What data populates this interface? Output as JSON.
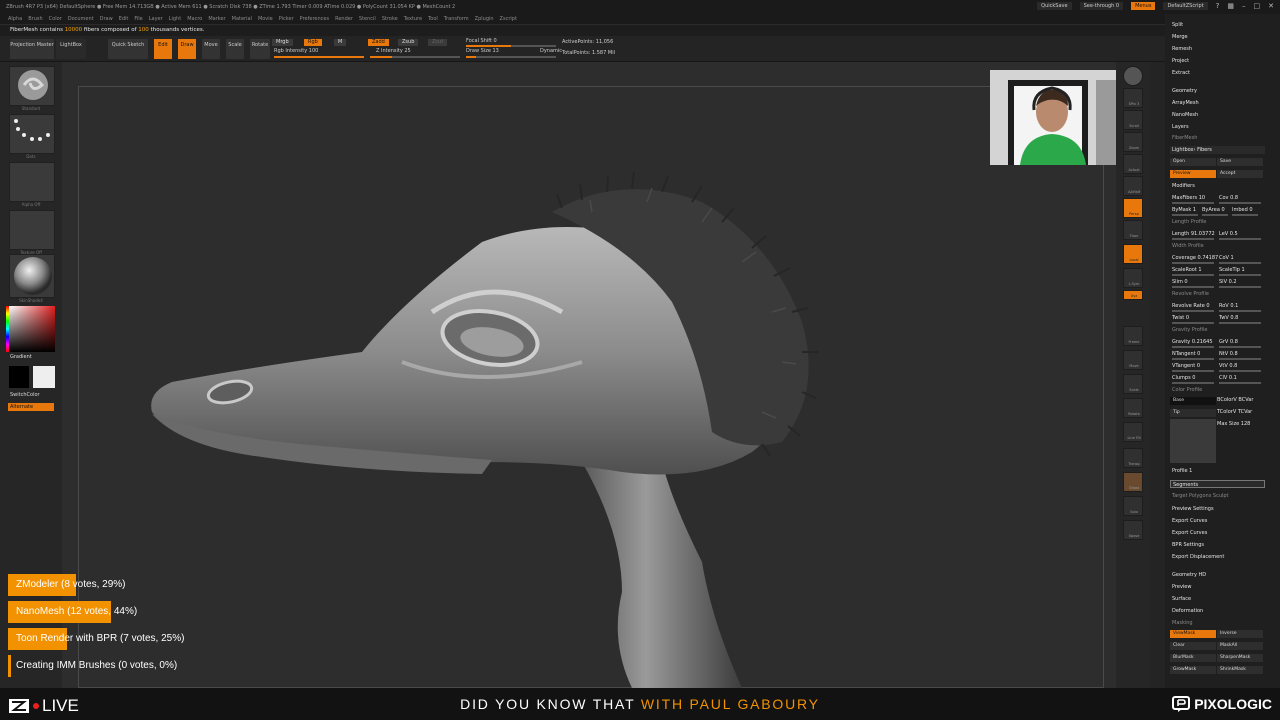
{
  "titlebar": {
    "title": "ZBrush 4R7 P3 (x64)   DefaultSphere   ● Free Mem 14.713GB ● Active Mem 611 ● Scratch Disk 738 ● ZTime 1.793 Timer 0.009 ATime 0.029 ● PolyCount 31.054 KP ● MeshCount 2",
    "quicksave": "QuickSave",
    "seethrough": "See-through  0",
    "menus_btn": "Menus",
    "script": "DefaultZScript"
  },
  "menubar": [
    "Alpha",
    "Brush",
    "Color",
    "Document",
    "Draw",
    "Edit",
    "File",
    "Layer",
    "Light",
    "Macro",
    "Marker",
    "Material",
    "Movie",
    "Picker",
    "Preferences",
    "Render",
    "Stencil",
    "Stroke",
    "Texture",
    "Tool",
    "Transform",
    "Zplugin",
    "Zscript"
  ],
  "notice": {
    "prefix": "FiberMesh contains ",
    "fibers": "10000",
    "mid": " fibers composed of ",
    "verts": "100",
    "suffix": " thousands vertices."
  },
  "toolbar": {
    "projection_master": "Projection Master",
    "lightbox": "LightBox",
    "quick_sketch": "Quick Sketch",
    "edit": "Edit",
    "draw": "Draw",
    "move": "Move",
    "scale": "Scale",
    "rotate": "Rotate",
    "mrgb": "Mrgb",
    "rgb": "Rgb",
    "m": "M",
    "rgb_intensity": "Rgb Intensity 100",
    "zadd": "Zadd",
    "zsub": "Zsub",
    "zcut": "Zcut",
    "z_intensity": "Z Intensity 25",
    "focal_shift": "Focal Shift 0",
    "draw_size": "Draw Size 13",
    "dynamic": "Dynamic",
    "active_points": "ActivePoints: 11,056",
    "total_points": "TotalPoints: 1.587 Mil"
  },
  "leftshelf": {
    "brush": "Standard",
    "stroke": "Dots",
    "alpha": "Alpha Off",
    "texture": "Texture Off",
    "material": "SkinShade4",
    "gradient": "Gradient",
    "switchcolor": "SwitchColor",
    "alternate": "Alternate"
  },
  "rightshelf": [
    "SPix 3",
    "Scroll",
    "Zoom",
    "Actual",
    "AAHalf",
    "Persp",
    "Floor",
    "Local",
    "L.Sym",
    "Xyz",
    "Frame",
    "Move",
    "Scale",
    "Rotate",
    "Line Fill",
    "Transp",
    "Ghost",
    "Solo",
    "Xpose"
  ],
  "tray": {
    "top": [
      "Split",
      "Merge",
      "Remesh",
      "Project",
      "Extract"
    ],
    "sub": [
      "Geometry",
      "ArrayMesh",
      "NanoMesh",
      "Layers",
      "FiberMesh"
    ],
    "lightbox_fibers": "Lightbox› Fibers",
    "open": "Open",
    "save": "Save",
    "preview": "Preview",
    "accept": "Accept",
    "modifiers": "Modifiers",
    "rows": [
      [
        "MaxFibers 10",
        "Cov 0.8"
      ],
      [
        "ByMask 1",
        "ByArea 0",
        "Imbed 0"
      ],
      [
        "Length Profile",
        ""
      ],
      [
        "Length 91.03772",
        "LeV 0.5"
      ],
      [
        "Width Profile",
        ""
      ],
      [
        "Coverage 0.74187",
        "CoV 1"
      ],
      [
        "ScaleRoot 1",
        "ScaleTip 1"
      ],
      [
        "Slim 0",
        "SlV 0.2"
      ],
      [
        "Revolve Profile",
        ""
      ],
      [
        "Revolve Rate 0",
        "RoV 0.1"
      ],
      [
        "Twist 0",
        "TwV 0.8"
      ],
      [
        "Gravity Profile",
        ""
      ],
      [
        "Gravity 0.21645",
        "GrV 0.8"
      ],
      [
        "NTangent 0",
        "NtV 0.8"
      ],
      [
        "VTangent 0",
        "VtV 0.8"
      ],
      [
        "Clumps 0",
        "ClV 0.1"
      ],
      [
        "Color Profile",
        ""
      ]
    ],
    "base": "Base",
    "tip": "Tip",
    "bcolor": "BColorV BCVar",
    "tcolor": "TColorV TCVar",
    "max_size": "Max Size 128",
    "profile": "Profile 1",
    "segments": "Segments",
    "target_polygons": "Target Polygons  Sculpt",
    "bottom_items": [
      "Preview Settings",
      "Export Curves",
      "Export Curves",
      "BPR Settings",
      "Export Displacement"
    ],
    "groups": [
      "Geometry HD",
      "Preview",
      "Surface",
      "Deformation",
      "Masking"
    ],
    "mask_buttons": [
      [
        "ViewMask",
        "Inverse"
      ],
      [
        "Clear",
        "MaskAll"
      ],
      [
        "BlurMask",
        "SharpenMask"
      ],
      [
        "GrowMask",
        "ShrinkMask"
      ]
    ]
  },
  "poll": [
    {
      "label": "ZModeler (8 votes, 29%)",
      "pct": 29
    },
    {
      "label": "NanoMesh (12 votes, 44%)",
      "pct": 44
    },
    {
      "label": "Toon Render with BPR (7 votes, 25%)",
      "pct": 25
    },
    {
      "label": "Creating IMM Brushes (0 votes, 0%)",
      "pct": 0
    }
  ],
  "bottombar": {
    "live": "LIVE",
    "prefix": "DID YOU KNOW THAT ",
    "highlight": "WITH PAUL GABOURY",
    "brand": "PIXOLOGIC"
  },
  "colors": {
    "accent": "#e8780c",
    "poll": "#f39200",
    "bg": "#2d2d2d"
  }
}
